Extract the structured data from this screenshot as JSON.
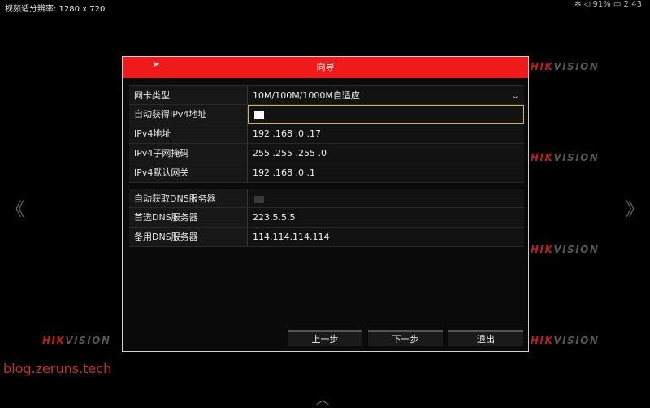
{
  "status_bar": {
    "resolution": "视频适分辨率: 1280 x 720",
    "system": "✻ ◁ 91% ▭ 2:43"
  },
  "watermarks": {
    "hik": "HIK",
    "vision": "VISION"
  },
  "blog": "blog.zeruns.tech",
  "nav": {
    "left_arrow": "《",
    "right_arrow": "》",
    "bottom_arrow": "︿"
  },
  "dialog": {
    "title": "向导",
    "rows": [
      {
        "label": "网卡类型",
        "value": "10M/100M/1000M自适应"
      },
      {
        "label": "自动获得IPv4地址",
        "value": ""
      },
      {
        "label": "IPv4地址",
        "value": "192 .168 .0     .17"
      },
      {
        "label": "IPv4子网掩码",
        "value": "255 .255 .255 .0"
      },
      {
        "label": "IPv4默认网关",
        "value": "192 .168 .0     .1"
      },
      {
        "label": "自动获取DNS服务器",
        "value": ""
      },
      {
        "label": "首选DNS服务器",
        "value": "223.5.5.5"
      },
      {
        "label": "备用DNS服务器",
        "value": "114.114.114.114"
      }
    ],
    "buttons": {
      "prev": "上一步",
      "next": "下一步",
      "exit": "退出"
    }
  }
}
